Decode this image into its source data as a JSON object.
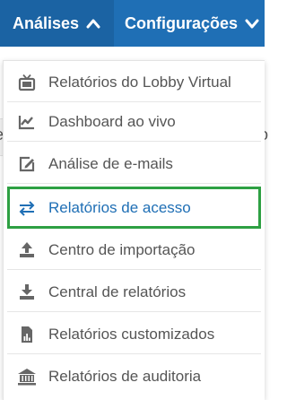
{
  "nav": {
    "analises_label": "Análises",
    "config_label": "Configurações"
  },
  "background": {
    "left_fragment": "e",
    "right_fragment": "co"
  },
  "menu": {
    "items": [
      {
        "label": "Relatórios do Lobby Virtual",
        "icon": "tv-icon",
        "active": false
      },
      {
        "label": "Dashboard ao vivo",
        "icon": "line-chart-icon",
        "active": false
      },
      {
        "label": "Análise de e-mails",
        "icon": "edit-icon",
        "active": false
      },
      {
        "label": "Relatórios de acesso",
        "icon": "exchange-icon",
        "active": true
      },
      {
        "label": "Centro de importação",
        "icon": "upload-icon",
        "active": false
      },
      {
        "label": "Central de relatórios",
        "icon": "download-icon",
        "active": false
      },
      {
        "label": "Relatórios customizados",
        "icon": "report-icon",
        "active": false
      },
      {
        "label": "Relatórios de auditoria",
        "icon": "bank-icon",
        "active": false
      }
    ]
  },
  "colors": {
    "nav_bg": "#1f6fb5",
    "nav_active_bg": "#1b63a3",
    "highlight_border": "#2ea043",
    "active_text": "#1f6fb5",
    "item_text": "#555555"
  }
}
